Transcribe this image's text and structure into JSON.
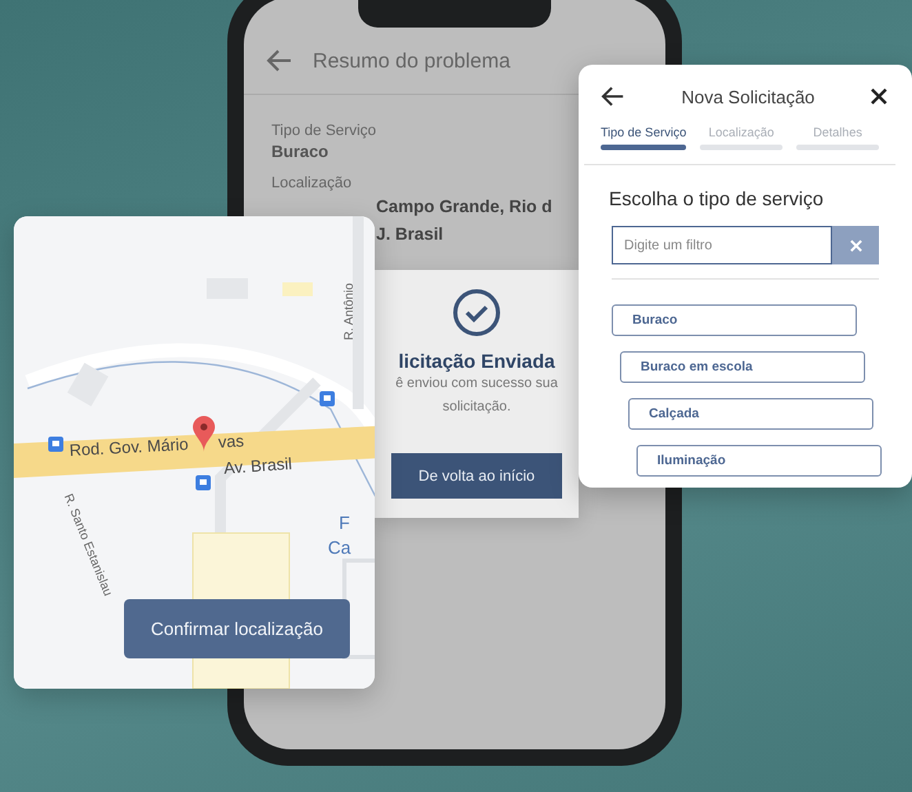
{
  "phone_screen": {
    "title": "Resumo do problema",
    "fields": [
      {
        "label": "Tipo de Serviço",
        "value": "Buraco"
      },
      {
        "label": "Localização"
      }
    ],
    "address_lines": [
      "Campo Grande, Rio d",
      "J. Brasil"
    ]
  },
  "success_dialog": {
    "title": "licitação Enviada",
    "message_lines": [
      "ê enviou com sucesso sua",
      "solicitação."
    ],
    "button": "De volta ao início"
  },
  "request_card": {
    "title": "Nova Solicitação",
    "steps": [
      {
        "label": "Tipo de Serviço",
        "selected": true
      },
      {
        "label": "Localização",
        "selected": false
      },
      {
        "label": "Detalhes",
        "selected": false
      }
    ],
    "heading": "Escolha o tipo de serviço",
    "filter": {
      "placeholder": "Digite um filtro"
    },
    "options": [
      "Buraco",
      "Buraco em escola",
      "Calçada",
      "Iluminação"
    ]
  },
  "map_card": {
    "road_labels": [
      "Rod. Gov. Mário",
      "vas",
      "Av. Brasil"
    ],
    "street_labels": [
      "R. Antônio",
      "R. Santo Estanislau"
    ],
    "edge_labels": [
      "F",
      "Ca"
    ],
    "button": "Confirmar localização"
  }
}
